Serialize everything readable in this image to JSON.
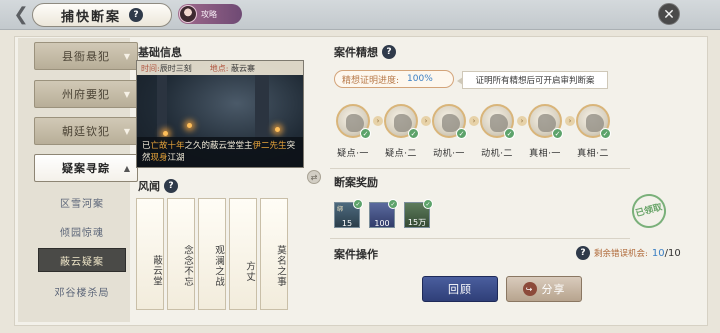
{
  "header": {
    "back_icon": "back-arrow-icon",
    "title": "捕快断案",
    "guide_label": "攻略",
    "close_icon": "close-icon"
  },
  "sidebar": {
    "items": [
      {
        "label": "县衙悬犯"
      },
      {
        "label": "州府要犯"
      },
      {
        "label": "朝廷钦犯"
      },
      {
        "label": "疑案寻踪"
      }
    ],
    "sub_items": [
      {
        "label": "区雪河案"
      },
      {
        "label": "倾园惊魂"
      },
      {
        "label": "蔽云疑案"
      },
      {
        "label": "邓谷楼杀局"
      }
    ]
  },
  "basic_info": {
    "heading": "基础信息",
    "time_label": "时间:",
    "time_value": "辰时三刻",
    "place_label": "地点:",
    "place_value": "蔽云寨",
    "caption_pre": "已",
    "caption_hl1": "亡故十年",
    "caption_mid": "之久的蔽云堂堂主",
    "caption_hl2": "伊二先生",
    "caption_mid2": "突然",
    "caption_hl3": "现身",
    "caption_post": "江湖"
  },
  "rumors": {
    "heading": "风闻",
    "cards": [
      {
        "label": "蔽云堂"
      },
      {
        "label": "念念不忘"
      },
      {
        "label": "观澜之战"
      },
      {
        "label": "方丈"
      },
      {
        "label": "莫名之事"
      }
    ]
  },
  "reasoning": {
    "heading": "案件精想",
    "progress_label": "精想证明进度:",
    "progress_value": "100%",
    "hint": "证明所有精想后可开启审判断案",
    "clues": [
      {
        "label": "疑点·一"
      },
      {
        "label": "疑点·二"
      },
      {
        "label": "动机·一"
      },
      {
        "label": "动机·二"
      },
      {
        "label": "真相·一"
      },
      {
        "label": "真相·二"
      }
    ]
  },
  "rewards": {
    "heading": "断案奖励",
    "items": [
      {
        "qty": "15",
        "tag": "绑"
      },
      {
        "qty": "100",
        "tag": ""
      },
      {
        "qty": "15万",
        "tag": ""
      }
    ],
    "claimed_stamp": "已领取"
  },
  "operations": {
    "heading": "案件操作",
    "chance_label": "剩余错误机会:",
    "chance_current": "10",
    "chance_total": "/10",
    "review_button": "回顾",
    "share_button": "分享"
  }
}
